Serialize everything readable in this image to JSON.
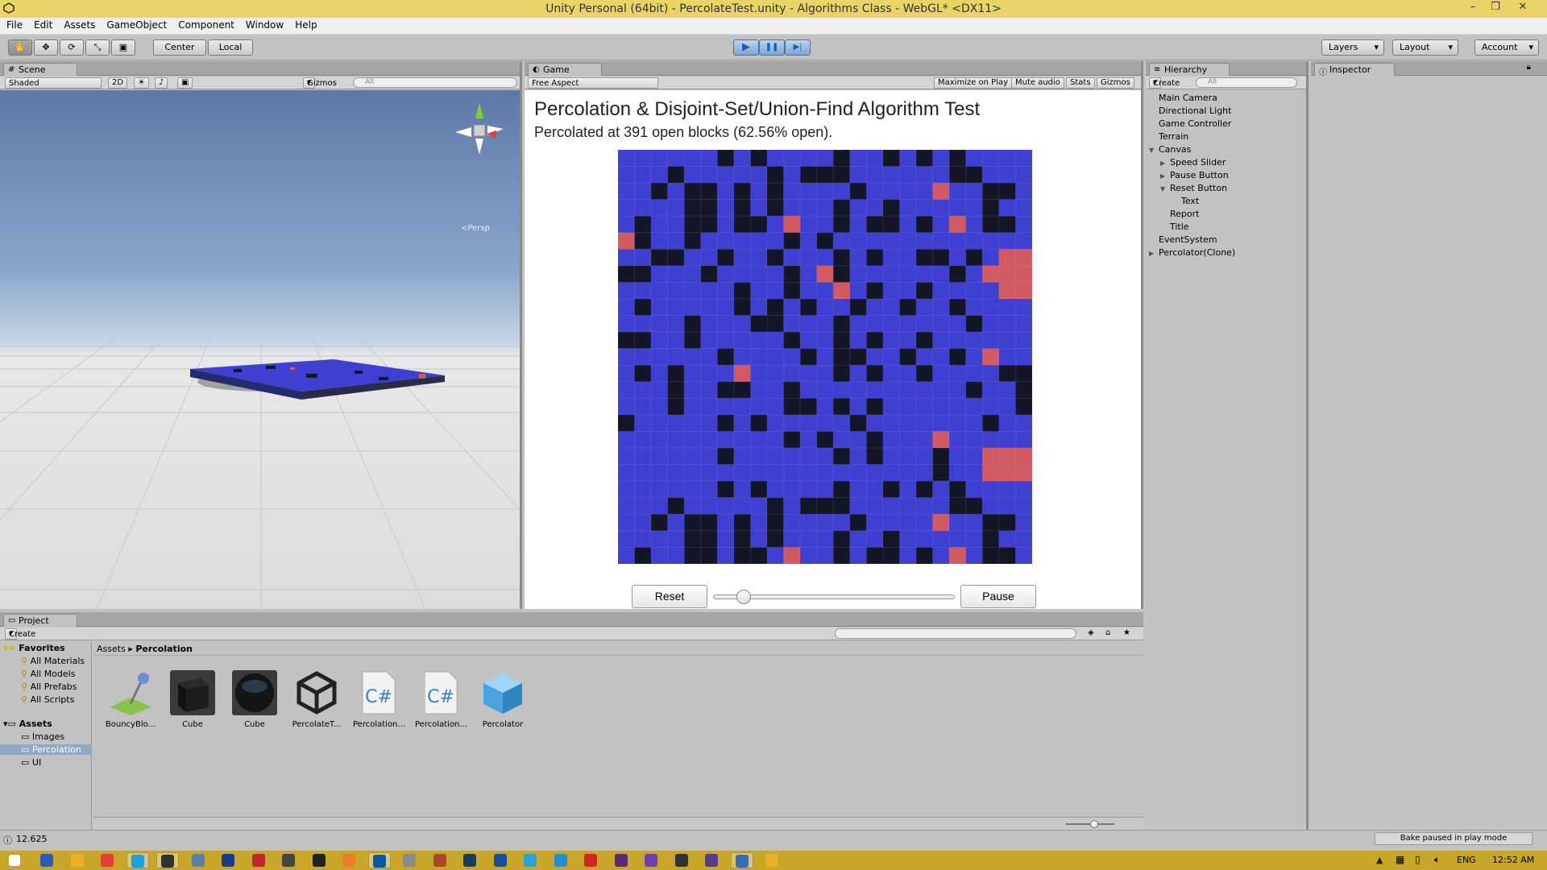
{
  "window": {
    "title": "Unity Personal (64bit) - PercolateTest.unity - Algorithms Class - WebGL* <DX11>",
    "controls": {
      "minimize": "–",
      "restore": "❐",
      "close": "✕"
    }
  },
  "menu": [
    "File",
    "Edit",
    "Assets",
    "GameObject",
    "Component",
    "Window",
    "Help"
  ],
  "toolbar": {
    "pivot_center": "Center",
    "pivot_local": "Local",
    "layers": "Layers",
    "layout": "Layout",
    "account": "Account",
    "play": "▶",
    "pause": "❚❚",
    "step": "▶|"
  },
  "scene": {
    "tab": "Scene",
    "shading": "Shaded",
    "mode_2d": "2D",
    "gizmos": "Gizmos",
    "search_placeholder": "All",
    "persp_label": "<Persp"
  },
  "game": {
    "tab": "Game",
    "aspect": "Free Aspect",
    "maximize": "Maximize on Play",
    "mute": "Mute audio",
    "stats": "Stats",
    "gizmos": "Gizmos",
    "heading": "Percolation & Disjoint-Set/Union-Find Algorithm Test",
    "report": "Percolated at 391 open blocks (62.56% open).",
    "reset_button": "Reset",
    "pause_button": "Pause",
    "speed_slider_value": 0.1,
    "grid_size": 25,
    "colors": {
      "open": "#3f3fd2",
      "closed": "#121626",
      "filled": "#d25a62"
    },
    "grid": [
      "OOOOOOCOCOOOOCOOCOCOCOOOO",
      "OOOCOOOOOCOCCCOOOOOOCCOOO",
      "OOCOCCOCOCOOOOCOOOOFOOCCO",
      "OOOOCCOCOCOOOCOOCOOOOOCOO",
      "OCOOCCOCCOFOOCOCCOCOFOCCO",
      "FCOOCOOOOOCOCOOOOOOOOOOOO",
      "OOCCOOCOOCOOOCOCOOCCOCOFF",
      "CCOOOCOOOOCOFCOOOOOOCOFFF",
      "OOOOOOOCOOCOOFOCOOCOOOOFF",
      "OCOOOOOCOCOCOOCOOCOOCOOOO",
      "OOOOCOOOCCOOOCOOOOOOOCOOO",
      "CCOOCOOOOOCOOCOCOOCOOOOOO",
      "OOOOOOCOOOOCOCCOOCOOCOFOO",
      "OCOCOOOFOOOOOCOCOOCOOOOCC",
      "OOOCOOCCOOCOOOOOOOOOOCOOC",
      "OOOCOOOOOOCCOCOCOOOOOOOOC",
      "COOOOOCOCOOOOOCOOOOOOOCOO",
      "OOOOOOOOOOCOCOOCOOOFOOOOO",
      "OOOOOOCOOOOOOCOCOOOCOOFFF",
      "OOOOOOOOOOOOOOOOOOOCOOFFF"
    ]
  },
  "hierarchy": {
    "tab": "Hierarchy",
    "create": "Create",
    "search_placeholder": "All",
    "items": [
      {
        "label": "Main Camera",
        "depth": 0,
        "arrow": ""
      },
      {
        "label": "Directional Light",
        "depth": 0,
        "arrow": ""
      },
      {
        "label": "Game Controller",
        "depth": 0,
        "arrow": ""
      },
      {
        "label": "Terrain",
        "depth": 0,
        "arrow": ""
      },
      {
        "label": "Canvas",
        "depth": 0,
        "arrow": "▼"
      },
      {
        "label": "Speed Slider",
        "depth": 1,
        "arrow": "▶"
      },
      {
        "label": "Pause Button",
        "depth": 1,
        "arrow": "▶"
      },
      {
        "label": "Reset Button",
        "depth": 1,
        "arrow": "▼"
      },
      {
        "label": "Text",
        "depth": 2,
        "arrow": ""
      },
      {
        "label": "Report",
        "depth": 1,
        "arrow": ""
      },
      {
        "label": "Title",
        "depth": 1,
        "arrow": ""
      },
      {
        "label": "EventSystem",
        "depth": 0,
        "arrow": ""
      },
      {
        "label": "Percolator(Clone)",
        "depth": 0,
        "arrow": "▶"
      }
    ]
  },
  "inspector": {
    "tab": "Inspector"
  },
  "project": {
    "tab": "Project",
    "create": "Create",
    "breadcrumb_root": "Assets",
    "breadcrumb_sep": "▸",
    "breadcrumb_current": "Percolation",
    "favorites_label": "Favorites",
    "favorites": [
      "All Materials",
      "All Models",
      "All Prefabs",
      "All Scripts"
    ],
    "assets_label": "Assets",
    "folders": [
      "Images",
      "Percolation",
      "UI"
    ],
    "selected_folder": "Percolation",
    "files": [
      {
        "name": "BouncyBlo...",
        "kind": "material"
      },
      {
        "name": "Cube",
        "kind": "cube-dark"
      },
      {
        "name": "Cube",
        "kind": "sphere-dark"
      },
      {
        "name": "PercolateT...",
        "kind": "unity-scene"
      },
      {
        "name": "Percolation...",
        "kind": "csharp"
      },
      {
        "name": "Percolation...",
        "kind": "csharp"
      },
      {
        "name": "Percolator",
        "kind": "prefab"
      }
    ]
  },
  "status": {
    "message": "12.625",
    "bake": "Bake paused in play mode"
  },
  "taskbar": {
    "language": "ENG",
    "time": "12:52 AM"
  }
}
